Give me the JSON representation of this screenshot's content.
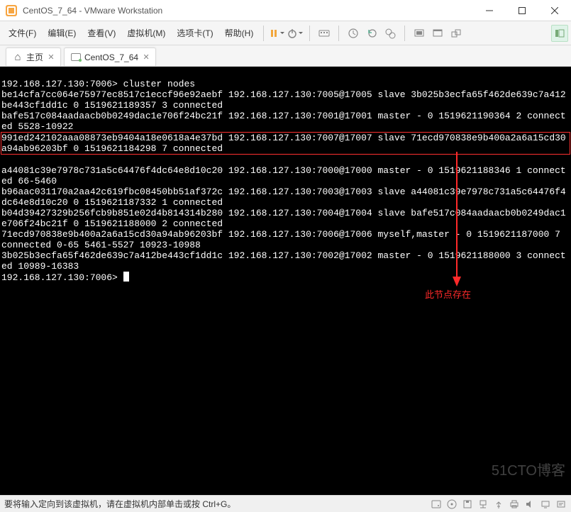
{
  "titlebar": {
    "title": "CentOS_7_64 - VMware Workstation"
  },
  "menu": {
    "file": "文件(F)",
    "edit": "编辑(E)",
    "view": "查看(V)",
    "vm": "虚拟机(M)",
    "tabs": "选项卡(T)",
    "help": "帮助(H)"
  },
  "tabs": {
    "home": "主页",
    "vm": "CentOS_7_64"
  },
  "terminal": {
    "pre_lines": "192.168.127.130:7006> cluster nodes\nbe14cfa7cc064e75977ec8517c1eccf96e92aebf 192.168.127.130:7005@17005 slave 3b025b3ecfa65f462de639c7a412be443cf1dd1c 0 1519621189357 3 connected\nbafe517c084aadaacb0b0249dac1e706f24bc21f 192.168.127.130:7001@17001 master - 0 1519621190364 2 connected 5528-10922",
    "highlight_lines": "991ed242102aaa08873eb9404a18e0618a4e37bd 192.168.127.130:7007@17007 slave 71ecd970838e9b400a2a6a15cd30a94ab96203bf 0 1519621184298 7 connected",
    "post_lines": "a44081c39e7978c731a5c64476f4dc64e8d10c20 192.168.127.130:7000@17000 master - 0 1519621188346 1 connected 66-5460\nb96aac031170a2aa42c619fbc08450bb51af372c 192.168.127.130:7003@17003 slave a44081c39e7978c731a5c64476f4dc64e8d10c20 0 1519621187332 1 connected\nb04d39427329b256fcb9b851e02d4b814314b280 192.168.127.130:7004@17004 slave bafe517c084aadaacb0b0249dac1e706f24bc21f 0 1519621188000 2 connected\n71ecd970838e9b400a2a6a15cd30a94ab96203bf 192.168.127.130:7006@17006 myself,master - 0 1519621187000 7 connected 0-65 5461-5527 10923-10988\n3b025b3ecfa65f462de639c7a412be443cf1dd1c 192.168.127.130:7002@17002 master - 0 1519621188000 3 connected 10989-16383",
    "prompt": "192.168.127.130:7006> "
  },
  "annotation": {
    "text": "此节点存在"
  },
  "statusbar": {
    "text": "要将输入定向到该虚拟机，请在虚拟机内部单击或按 Ctrl+G。"
  },
  "watermark": "51CTO博客"
}
